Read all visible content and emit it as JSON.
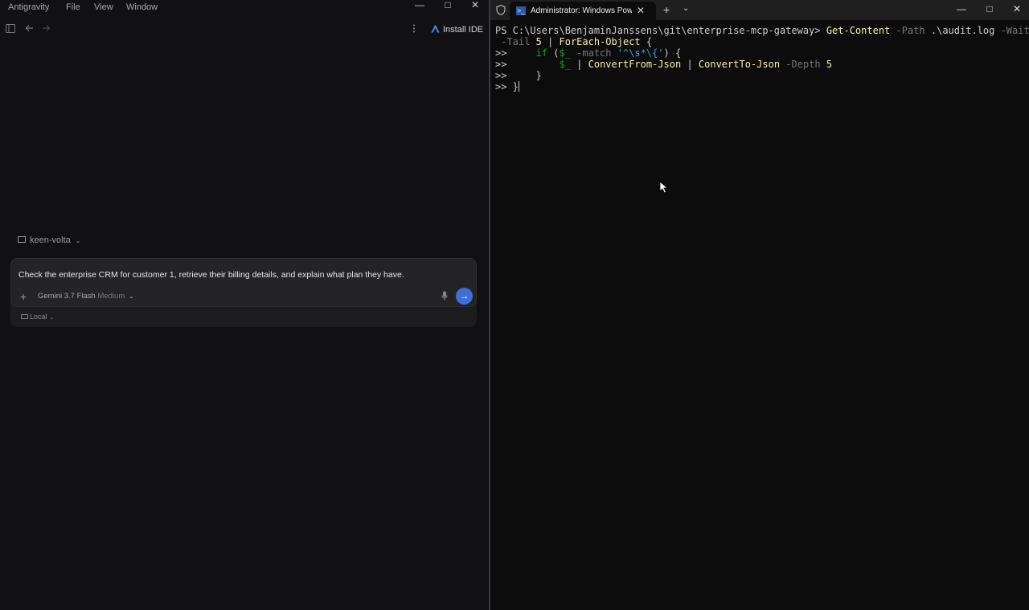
{
  "left_window": {
    "menu": [
      "Antigravity",
      "File",
      "View",
      "Window"
    ],
    "window_controls": {
      "minimize": "—",
      "maximize": "□",
      "close": "✕"
    },
    "install_label": "Install IDE",
    "workspace": "keen-volta",
    "prompt": "Check the enterprise CRM for customer 1, retrieve their billing details, and explain what plan they have.",
    "model_name": "Gemini 3.7 Flash",
    "model_variant": "Medium",
    "mode": "Local",
    "accent": "#3e6fd8"
  },
  "terminal_window": {
    "tab_title": "Administrator: Windows PowerShell",
    "controls": {
      "minimize": "—",
      "maximize": "□",
      "close": "✕"
    },
    "lines": {
      "l1_prompt": "PS C:\\Users\\BenjaminJanssens\\git\\enterprise-mcp-gateway> ",
      "l1_cmd": "Get-Content",
      "l1_p1": " -Path",
      "l1_arg1": " .\\audit.log",
      "l1_p2": " -Wait",
      "l2_p": " -Tail",
      "l2_num": " 5",
      "l2_pipe": " | ",
      "l2_cmd": "ForEach-Object",
      "l2_brace": " {",
      "cont": ">>",
      "l3_kw": "     if",
      "l3_open": " (",
      "l3_var": "$_",
      "l3_p": " -match",
      "l3_str": " '^\\s*\\{'",
      "l3_close": ") {",
      "l4_var": "         $_",
      "l4_pipe1": " | ",
      "l4_cmd1": "ConvertFrom-Json",
      "l4_pipe2": " | ",
      "l4_cmd2": "ConvertTo-Json",
      "l4_p": " -Depth",
      "l4_num": " 5",
      "l5_close": "     }",
      "l6_close": " }"
    }
  }
}
